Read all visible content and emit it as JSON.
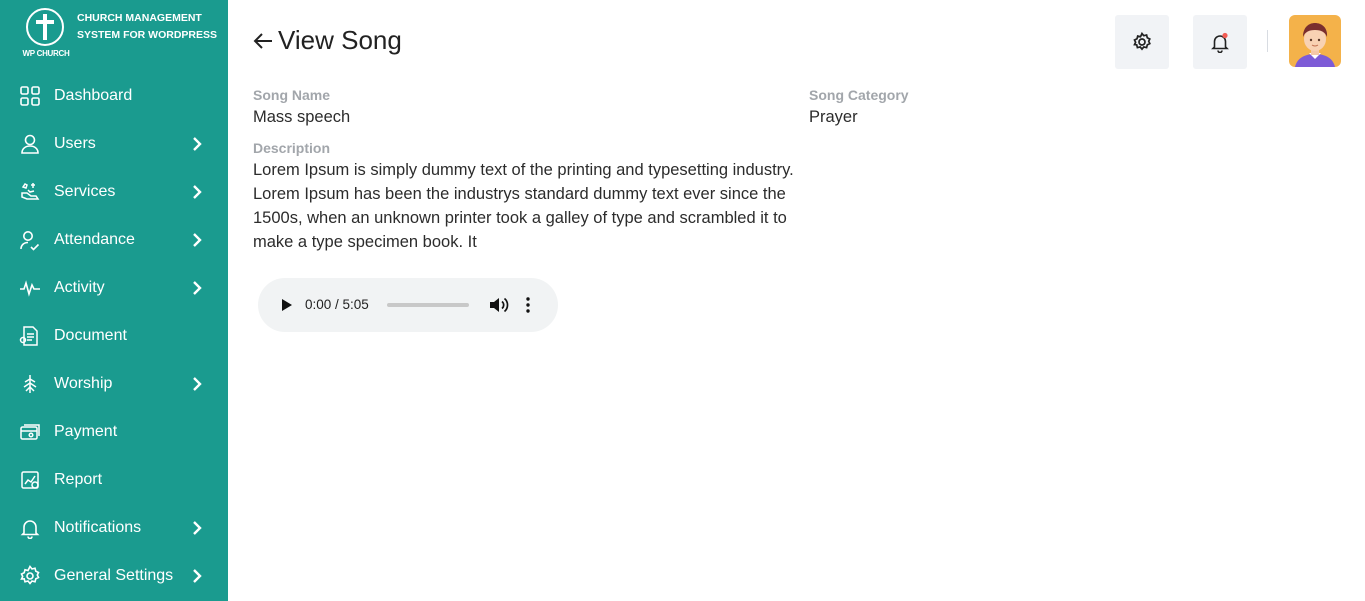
{
  "brand": {
    "logo_text": "WP CHURCH",
    "title": "CHURCH MANAGEMENT SYSTEM FOR WORDPRESS"
  },
  "sidebar": {
    "items": [
      {
        "label": "Dashboard",
        "icon": "dashboard-icon",
        "has_submenu": false
      },
      {
        "label": "Users",
        "icon": "user-icon",
        "has_submenu": true
      },
      {
        "label": "Services",
        "icon": "services-icon",
        "has_submenu": true
      },
      {
        "label": "Attendance",
        "icon": "attendance-icon",
        "has_submenu": true
      },
      {
        "label": "Activity",
        "icon": "activity-icon",
        "has_submenu": true
      },
      {
        "label": "Document",
        "icon": "document-icon",
        "has_submenu": false
      },
      {
        "label": "Worship",
        "icon": "worship-icon",
        "has_submenu": true
      },
      {
        "label": "Payment",
        "icon": "payment-icon",
        "has_submenu": false
      },
      {
        "label": "Report",
        "icon": "report-icon",
        "has_submenu": false
      },
      {
        "label": "Notifications",
        "icon": "bell-icon",
        "has_submenu": true
      },
      {
        "label": "General Settings",
        "icon": "gear-icon",
        "has_submenu": true
      }
    ]
  },
  "header": {
    "title": "View Song",
    "settings_icon": "gear-icon",
    "notification_icon": "bell-icon",
    "notification_dot_color": "#f25c54"
  },
  "song": {
    "name_label": "Song Name",
    "name_value": "Mass speech",
    "category_label": "Song Category",
    "category_value": "Prayer",
    "description_label": "Description",
    "description_value": "Lorem Ipsum is simply dummy text of the printing and typesetting industry. Lorem Ipsum has been the industrys standard dummy text ever since the 1500s, when an unknown printer took a galley of type and scrambled it to make a type specimen book. It"
  },
  "audio": {
    "time": "0:00 / 5:05",
    "progress": 0
  },
  "colors": {
    "sidebar_bg": "#1a9b8f",
    "header_button_bg": "#f1f3f6",
    "avatar_bg": "#f4b24a"
  }
}
